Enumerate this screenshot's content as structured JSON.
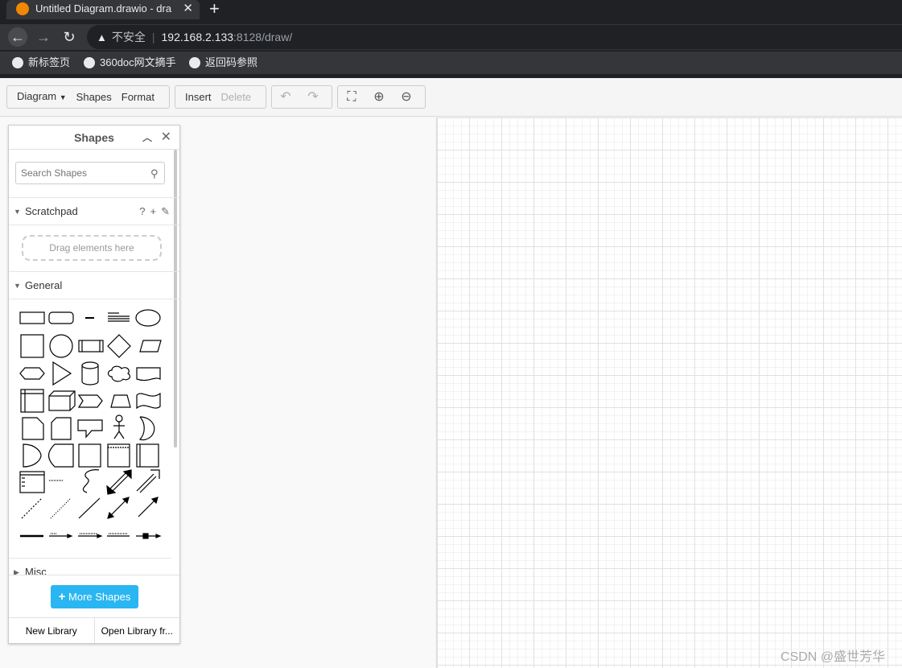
{
  "browser": {
    "tab_title": "Untitled Diagram.drawio - dra",
    "new_tab_symbol": "+",
    "close_symbol": "✕",
    "security_label": "不安全",
    "url_host": "192.168.2.133",
    "url_path": ":8128/draw/",
    "bookmarks": [
      "新标签页",
      "360doc网文摘手",
      "返回码参照"
    ]
  },
  "toolbar": {
    "diagram": "Diagram",
    "shapes": "Shapes",
    "format": "Format",
    "insert": "Insert",
    "delete": "Delete"
  },
  "panel": {
    "title": "Shapes",
    "search_placeholder": "Search Shapes",
    "scratchpad": "Scratchpad",
    "drag_hint": "Drag elements here",
    "general": "General",
    "misc": "Misc",
    "more_shapes": "More Shapes",
    "new_library": "New Library",
    "open_library": "Open Library fr..."
  },
  "watermark": "CSDN @盛世芳华",
  "colors": {
    "accent": "#29b6f2",
    "chrome_dark": "#202124",
    "drawio_orange": "#f08705"
  }
}
